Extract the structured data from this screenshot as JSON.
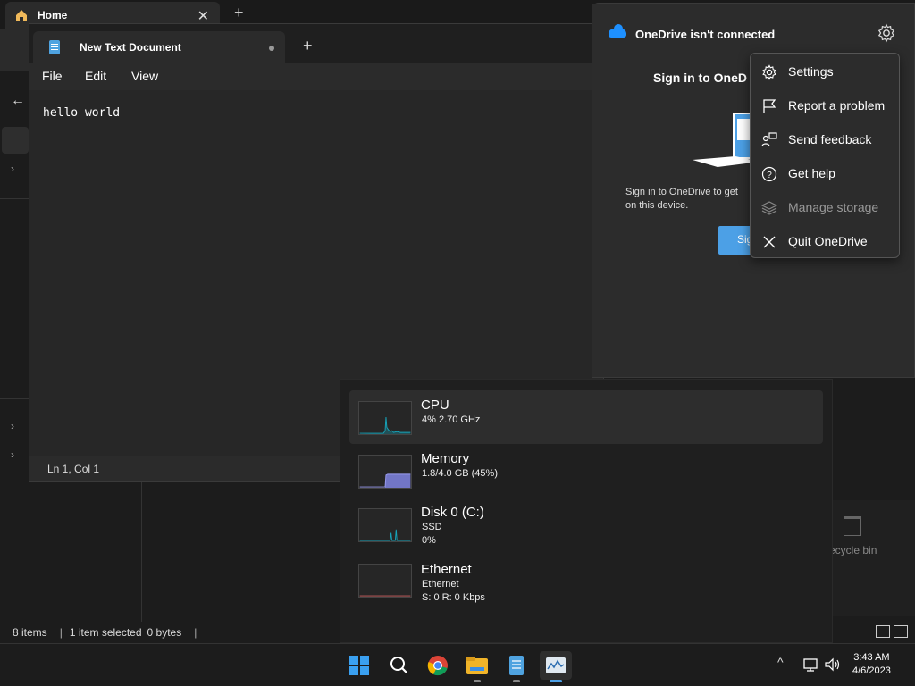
{
  "explorer": {
    "tab_title": "Home",
    "tab_close": "✕",
    "new_tab": "+",
    "back_arrow": "←",
    "status": {
      "items": "8 items",
      "selected": "1 item selected",
      "size": "0 bytes"
    },
    "recycle_bin_label": "ecycle bin"
  },
  "notepad": {
    "tab_title": "New Text Document",
    "new_tab": "+",
    "menu": [
      "File",
      "Edit",
      "View"
    ],
    "content": "hello world",
    "status_position": "Ln 1, Col 1"
  },
  "onedrive": {
    "title": "OneDrive isn't connected",
    "signin_title": "Sign in to OneD",
    "description_line1": "Sign in to OneDrive to get",
    "description_line2": "on this device.",
    "signin_button": "Sig",
    "menu": [
      {
        "label": "Settings",
        "icon": "gear-icon",
        "disabled": false
      },
      {
        "label": "Report a problem",
        "icon": "flag-icon",
        "disabled": false
      },
      {
        "label": "Send feedback",
        "icon": "feedback-icon",
        "disabled": false
      },
      {
        "label": "Get help",
        "icon": "help-icon",
        "disabled": false
      },
      {
        "label": "Manage storage",
        "icon": "storage-icon",
        "disabled": true
      },
      {
        "label": "Quit OneDrive",
        "icon": "close-icon",
        "disabled": false
      }
    ]
  },
  "taskmanager": {
    "cpu": {
      "name": "CPU",
      "detail": "4%  2.70 GHz"
    },
    "memory": {
      "name": "Memory",
      "detail": "1.8/4.0 GB (45%)"
    },
    "disk": {
      "name": "Disk 0 (C:)",
      "type": "SSD",
      "usage": "0%"
    },
    "ethernet": {
      "name": "Ethernet",
      "type": "Ethernet",
      "speed": "S: 0  R: 0 Kbps"
    }
  },
  "taskbar": {
    "tray_chevron": "^",
    "time": "3:43 AM",
    "date": "4/6/2023"
  },
  "colors": {
    "accent": "#4ca0e6",
    "onedrive_blue": "#1e90ff",
    "cpu_graph": "#17a2b8",
    "memory_graph": "#7b7fd8"
  }
}
